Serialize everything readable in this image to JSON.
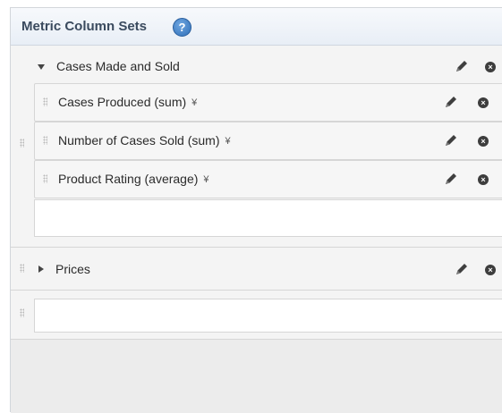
{
  "header": {
    "title": "Metric Column Sets",
    "help_glyph": "?"
  },
  "sets": [
    {
      "label": "Cases Made and Sold",
      "expanded": true,
      "metrics": [
        {
          "label": "Cases Produced (sum)",
          "chevron": "¥"
        },
        {
          "label": "Number of Cases Sold (sum)",
          "chevron": "¥"
        },
        {
          "label": "Product Rating (average)",
          "chevron": "¥"
        }
      ]
    },
    {
      "label": "Prices",
      "expanded": false
    }
  ],
  "icons": {
    "remove_glyph": "×"
  },
  "colors": {
    "header_title": "#3a4a5e",
    "help_icon": "#2f6fb8",
    "panel_bg": "#ececec"
  }
}
